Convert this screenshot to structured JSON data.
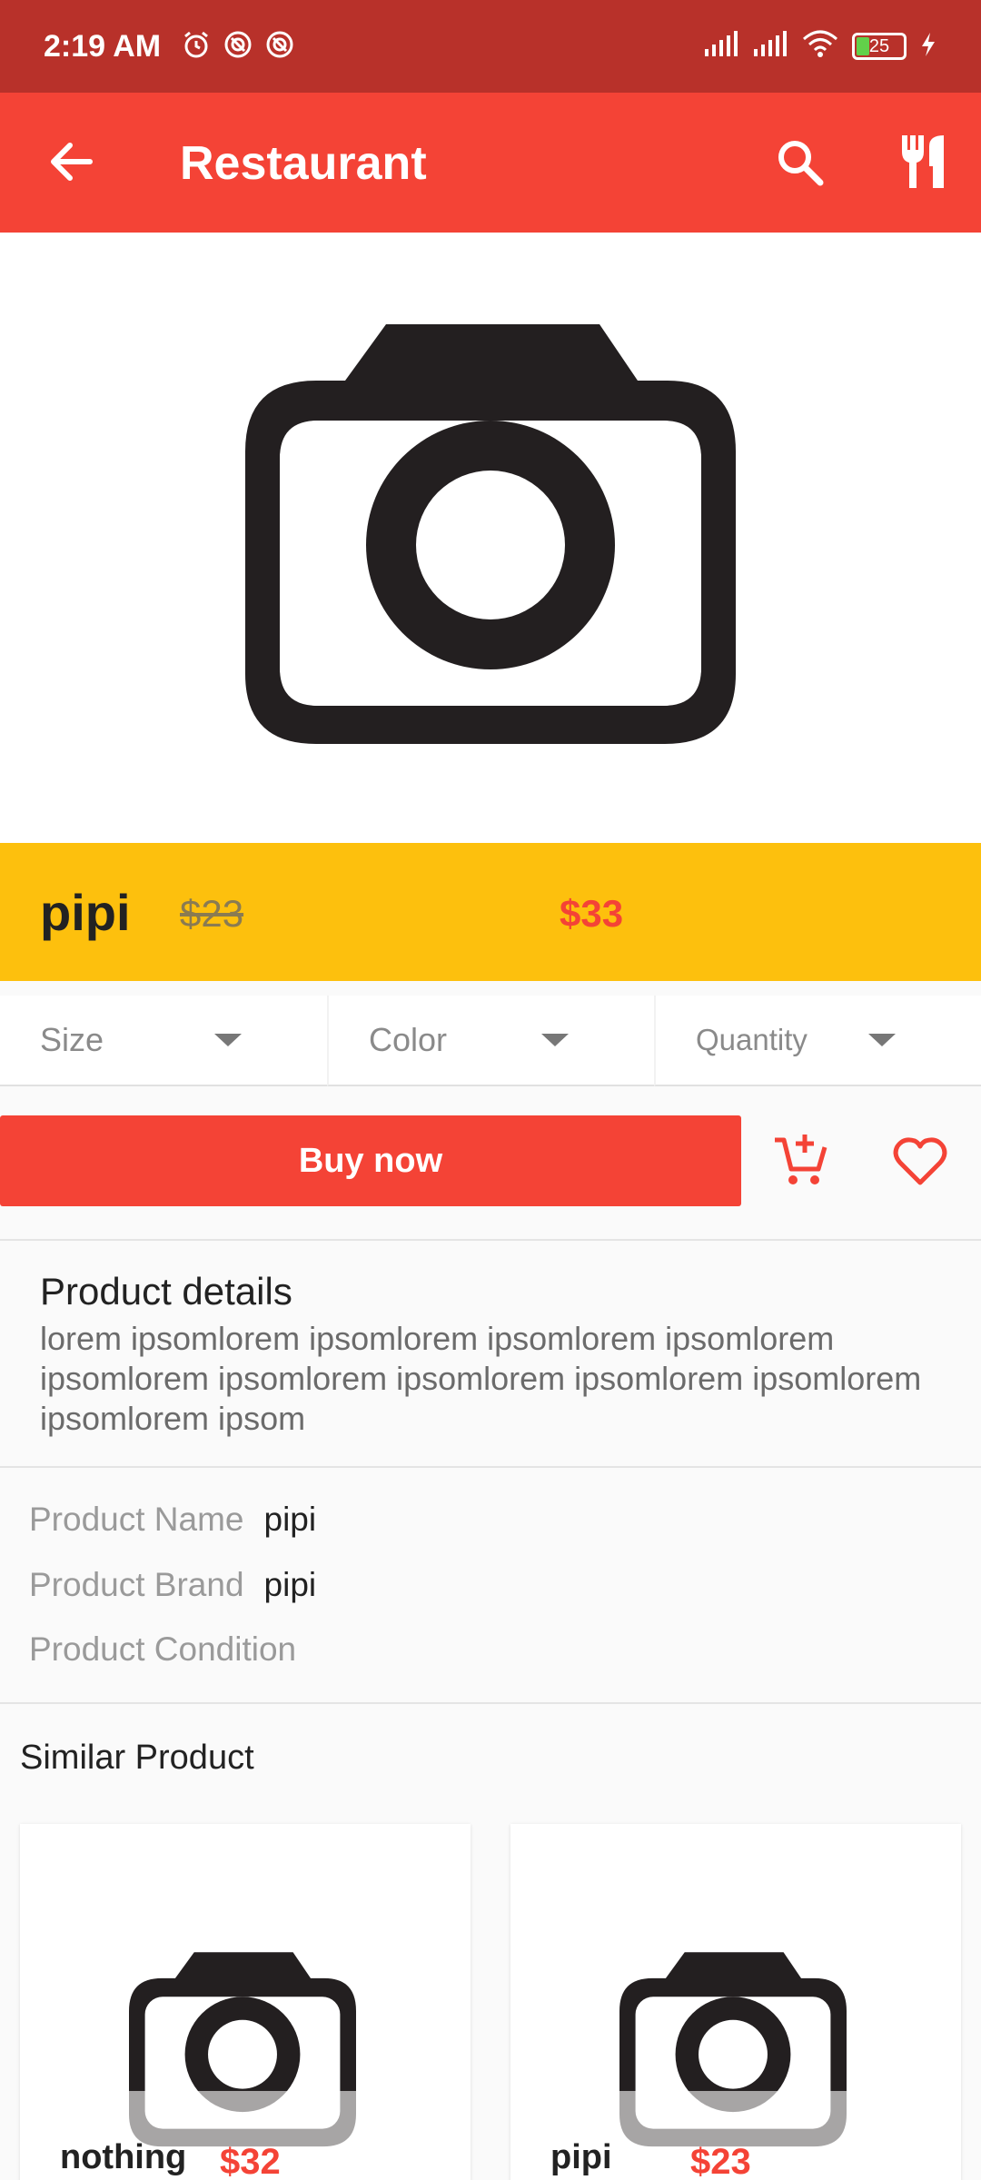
{
  "status_bar": {
    "time": "2:19 AM",
    "battery": "25",
    "icons": [
      "alarm-icon",
      "vpn-icon",
      "sync-icon",
      "signal-icon",
      "signal-icon",
      "wifi-icon",
      "battery-icon",
      "charging-icon"
    ]
  },
  "app_bar": {
    "title": "Restaurant",
    "icons": [
      "back-arrow-icon",
      "search-icon",
      "fork-knife-icon"
    ]
  },
  "product": {
    "name": "pipi",
    "old_price": "$23",
    "new_price": "$33"
  },
  "selectors": {
    "size": "Size",
    "color": "Color",
    "quantity": "Quantity"
  },
  "actions": {
    "buy_label": "Buy now"
  },
  "details": {
    "title": "Product details",
    "text": "lorem ipsomlorem ipsomlorem ipsomlorem ipsomlorem ipsomlorem ipsomlorem ipsomlorem ipsomlorem ipsomlorem ipsomlorem ipsom"
  },
  "specs": [
    {
      "label": "Product Name",
      "value": "pipi"
    },
    {
      "label": "Product Brand",
      "value": "pipi"
    },
    {
      "label": "Product Condition",
      "value": ""
    }
  ],
  "similar": {
    "title": "Similar Product",
    "items": [
      {
        "name": "nothing",
        "price": "$32"
      },
      {
        "name": "pipi",
        "price": "$23"
      }
    ]
  },
  "colors": {
    "status_bar": "#b8312a",
    "primary": "#f44336",
    "accent": "#fdc00d"
  }
}
